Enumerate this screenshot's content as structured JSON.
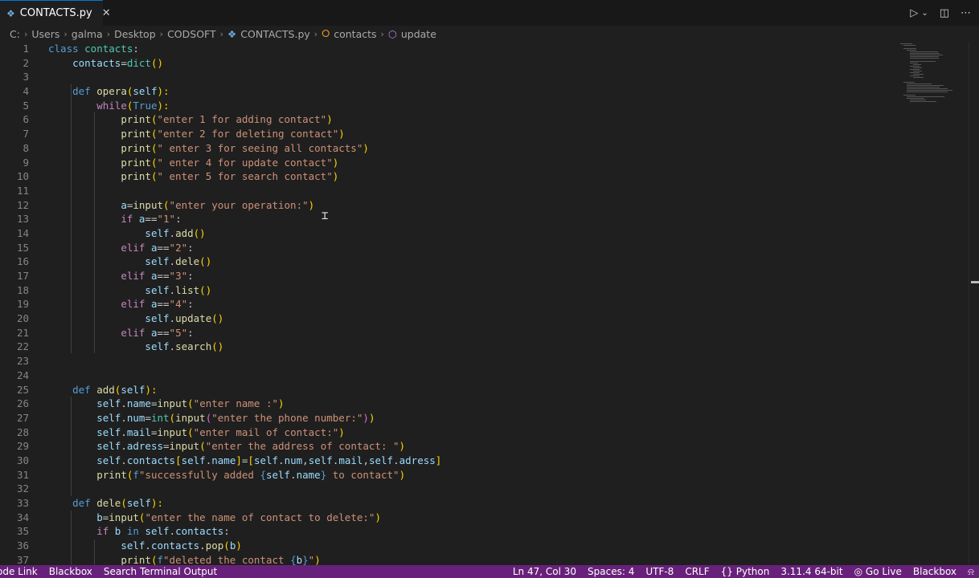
{
  "tab": {
    "icon": "python-file-icon",
    "label": "CONTACTS.py"
  },
  "breadcrumb": [
    "C:",
    "Users",
    "galma",
    "Desktop",
    "CODSOFT",
    "CONTACTS.py",
    "contacts",
    "update"
  ],
  "lines": [
    [
      [
        "kw",
        "class "
      ],
      [
        "cls",
        "contacts"
      ],
      [
        "",
        ":"
      ]
    ],
    [
      [
        "",
        "    "
      ],
      [
        "var",
        "contacts"
      ],
      [
        "",
        "="
      ],
      [
        "cls",
        "dict"
      ],
      [
        "br1",
        "()"
      ]
    ],
    [
      [
        "",
        ""
      ]
    ],
    [
      [
        "",
        "    "
      ],
      [
        "kw",
        "def "
      ],
      [
        "fn",
        "opera"
      ],
      [
        "br1",
        "("
      ],
      [
        "var",
        "self"
      ],
      [
        "br1",
        "):"
      ]
    ],
    [
      [
        "",
        "        "
      ],
      [
        "ctl",
        "while"
      ],
      [
        "br1",
        "("
      ],
      [
        "kw",
        "True"
      ],
      [
        "br1",
        "):"
      ]
    ],
    [
      [
        "",
        "            "
      ],
      [
        "fn",
        "print"
      ],
      [
        "br1",
        "("
      ],
      [
        "str",
        "\"enter 1 for adding contact\""
      ],
      [
        "br1",
        ")"
      ]
    ],
    [
      [
        "",
        "            "
      ],
      [
        "fn",
        "print"
      ],
      [
        "br1",
        "("
      ],
      [
        "str",
        "\"enter 2 for deleting contact\""
      ],
      [
        "br1",
        ")"
      ]
    ],
    [
      [
        "",
        "            "
      ],
      [
        "fn",
        "print"
      ],
      [
        "br1",
        "("
      ],
      [
        "str",
        "\" enter 3 for seeing all contacts\""
      ],
      [
        "br1",
        ")"
      ]
    ],
    [
      [
        "",
        "            "
      ],
      [
        "fn",
        "print"
      ],
      [
        "br1",
        "("
      ],
      [
        "str",
        "\" enter 4 for update contact\""
      ],
      [
        "br1",
        ")"
      ]
    ],
    [
      [
        "",
        "            "
      ],
      [
        "fn",
        "print"
      ],
      [
        "br1",
        "("
      ],
      [
        "str",
        "\" enter 5 for search contact\""
      ],
      [
        "br1",
        ")"
      ]
    ],
    [
      [
        "",
        ""
      ]
    ],
    [
      [
        "",
        "            "
      ],
      [
        "var",
        "a"
      ],
      [
        "",
        "="
      ],
      [
        "fn",
        "input"
      ],
      [
        "br1",
        "("
      ],
      [
        "str",
        "\"enter your operation:\""
      ],
      [
        "br1",
        ")"
      ]
    ],
    [
      [
        "",
        "            "
      ],
      [
        "ctl",
        "if "
      ],
      [
        "var",
        "a"
      ],
      [
        "",
        "=="
      ],
      [
        "str",
        "\"1\""
      ],
      [
        "",
        ":"
      ]
    ],
    [
      [
        "",
        "                "
      ],
      [
        "var",
        "self"
      ],
      [
        "",
        "."
      ],
      [
        "fn",
        "add"
      ],
      [
        "br1",
        "()"
      ]
    ],
    [
      [
        "",
        "            "
      ],
      [
        "ctl",
        "elif "
      ],
      [
        "var",
        "a"
      ],
      [
        "",
        "=="
      ],
      [
        "str",
        "\"2\""
      ],
      [
        "",
        ":"
      ]
    ],
    [
      [
        "",
        "                "
      ],
      [
        "var",
        "self"
      ],
      [
        "",
        "."
      ],
      [
        "fn",
        "dele"
      ],
      [
        "br1",
        "()"
      ]
    ],
    [
      [
        "",
        "            "
      ],
      [
        "ctl",
        "elif "
      ],
      [
        "var",
        "a"
      ],
      [
        "",
        "=="
      ],
      [
        "str",
        "\"3\""
      ],
      [
        "",
        ":"
      ]
    ],
    [
      [
        "",
        "                "
      ],
      [
        "var",
        "self"
      ],
      [
        "",
        "."
      ],
      [
        "fn",
        "list"
      ],
      [
        "br1",
        "()"
      ]
    ],
    [
      [
        "",
        "            "
      ],
      [
        "ctl",
        "elif "
      ],
      [
        "var",
        "a"
      ],
      [
        "",
        "=="
      ],
      [
        "str",
        "\"4\""
      ],
      [
        "",
        ":"
      ]
    ],
    [
      [
        "",
        "                "
      ],
      [
        "var",
        "self"
      ],
      [
        "",
        "."
      ],
      [
        "fn",
        "update"
      ],
      [
        "br1",
        "()"
      ]
    ],
    [
      [
        "",
        "            "
      ],
      [
        "ctl",
        "elif "
      ],
      [
        "var",
        "a"
      ],
      [
        "",
        "=="
      ],
      [
        "str",
        "\"5\""
      ],
      [
        "",
        ":"
      ]
    ],
    [
      [
        "",
        "                "
      ],
      [
        "var",
        "self"
      ],
      [
        "",
        "."
      ],
      [
        "fn",
        "search"
      ],
      [
        "br1",
        "()"
      ]
    ],
    [
      [
        "",
        ""
      ]
    ],
    [
      [
        "",
        ""
      ]
    ],
    [
      [
        "",
        "    "
      ],
      [
        "kw",
        "def "
      ],
      [
        "fn",
        "add"
      ],
      [
        "br1",
        "("
      ],
      [
        "var",
        "self"
      ],
      [
        "br1",
        "):"
      ]
    ],
    [
      [
        "",
        "        "
      ],
      [
        "var",
        "self"
      ],
      [
        "",
        "."
      ],
      [
        "var",
        "name"
      ],
      [
        "",
        "="
      ],
      [
        "fn",
        "input"
      ],
      [
        "br1",
        "("
      ],
      [
        "str",
        "\"enter name :\""
      ],
      [
        "br1",
        ")"
      ]
    ],
    [
      [
        "",
        "        "
      ],
      [
        "var",
        "self"
      ],
      [
        "",
        "."
      ],
      [
        "var",
        "num"
      ],
      [
        "",
        "="
      ],
      [
        "cls",
        "int"
      ],
      [
        "br1",
        "("
      ],
      [
        "fn",
        "input"
      ],
      [
        "br2",
        "("
      ],
      [
        "str",
        "\"enter the phone number:\""
      ],
      [
        "br2",
        ")"
      ],
      [
        "br1",
        ")"
      ]
    ],
    [
      [
        "",
        "        "
      ],
      [
        "var",
        "self"
      ],
      [
        "",
        "."
      ],
      [
        "var",
        "mail"
      ],
      [
        "",
        "="
      ],
      [
        "fn",
        "input"
      ],
      [
        "br1",
        "("
      ],
      [
        "str",
        "\"enter mail of contact:\""
      ],
      [
        "br1",
        ")"
      ]
    ],
    [
      [
        "",
        "        "
      ],
      [
        "var",
        "self"
      ],
      [
        "",
        "."
      ],
      [
        "var",
        "adress"
      ],
      [
        "",
        "="
      ],
      [
        "fn",
        "input"
      ],
      [
        "br1",
        "("
      ],
      [
        "str",
        "\"enter the address of contact: \""
      ],
      [
        "br1",
        ")"
      ]
    ],
    [
      [
        "",
        "        "
      ],
      [
        "var",
        "self"
      ],
      [
        "",
        "."
      ],
      [
        "var",
        "contacts"
      ],
      [
        "br1",
        "["
      ],
      [
        "var",
        "self"
      ],
      [
        "",
        "."
      ],
      [
        "var",
        "name"
      ],
      [
        "br1",
        "]"
      ],
      [
        "",
        "="
      ],
      [
        "br1",
        "["
      ],
      [
        "var",
        "self"
      ],
      [
        "",
        "."
      ],
      [
        "var",
        "num"
      ],
      [
        "",
        ","
      ],
      [
        "var",
        "self"
      ],
      [
        "",
        "."
      ],
      [
        "var",
        "mail"
      ],
      [
        "",
        ","
      ],
      [
        "var",
        "self"
      ],
      [
        "",
        "."
      ],
      [
        "var",
        "adress"
      ],
      [
        "br1",
        "]"
      ]
    ],
    [
      [
        "",
        "        "
      ],
      [
        "fn",
        "print"
      ],
      [
        "br1",
        "("
      ],
      [
        "kw",
        "f"
      ],
      [
        "str",
        "\"successfully added "
      ],
      [
        "kw",
        "{"
      ],
      [
        "var",
        "self"
      ],
      [
        "",
        "."
      ],
      [
        "var",
        "name"
      ],
      [
        "kw",
        "}"
      ],
      [
        "str",
        " to contact\""
      ],
      [
        "br1",
        ")"
      ]
    ],
    [
      [
        "",
        ""
      ]
    ],
    [
      [
        "",
        "    "
      ],
      [
        "kw",
        "def "
      ],
      [
        "fn",
        "dele"
      ],
      [
        "br1",
        "("
      ],
      [
        "var",
        "self"
      ],
      [
        "br1",
        "):"
      ]
    ],
    [
      [
        "",
        "        "
      ],
      [
        "var",
        "b"
      ],
      [
        "",
        "="
      ],
      [
        "fn",
        "input"
      ],
      [
        "br1",
        "("
      ],
      [
        "str",
        "\"enter the name of contact to delete:\""
      ],
      [
        "br1",
        ")"
      ]
    ],
    [
      [
        "",
        "        "
      ],
      [
        "ctl",
        "if "
      ],
      [
        "var",
        "b"
      ],
      [
        "kw",
        " in "
      ],
      [
        "var",
        "self"
      ],
      [
        "",
        "."
      ],
      [
        "var",
        "contacts"
      ],
      [
        "",
        ":"
      ]
    ],
    [
      [
        "",
        "            "
      ],
      [
        "var",
        "self"
      ],
      [
        "",
        "."
      ],
      [
        "var",
        "contacts"
      ],
      [
        "",
        "."
      ],
      [
        "fn",
        "pop"
      ],
      [
        "br1",
        "("
      ],
      [
        "var",
        "b"
      ],
      [
        "br1",
        ")"
      ]
    ],
    [
      [
        "",
        "            "
      ],
      [
        "fn",
        "print"
      ],
      [
        "br1",
        "("
      ],
      [
        "kw",
        "f"
      ],
      [
        "str",
        "\"deleted the contact "
      ],
      [
        "kw",
        "{"
      ],
      [
        "var",
        "b"
      ],
      [
        "kw",
        "}"
      ],
      [
        "str",
        "\""
      ],
      [
        "br1",
        ")"
      ]
    ]
  ],
  "status": {
    "left": [
      "ode Link",
      "Blackbox",
      "Search Terminal Output"
    ],
    "position": "Ln 47, Col 30",
    "spaces": "Spaces: 4",
    "encoding": "UTF-8",
    "eol": "CRLF",
    "language": "Python",
    "interpreter": "3.11.4 64-bit",
    "golive": "Go Live",
    "blackbox": "Blackbox"
  },
  "colors": {
    "statusbar": "#68217a",
    "editor_bg": "#1f1f1f",
    "tab_accent": "#0078d4"
  },
  "icons": [
    "run-icon",
    "chevron-down-icon",
    "split-editor-icon",
    "more-actions-icon",
    "bell-icon",
    "braces-icon",
    "broadcast-icon"
  ]
}
